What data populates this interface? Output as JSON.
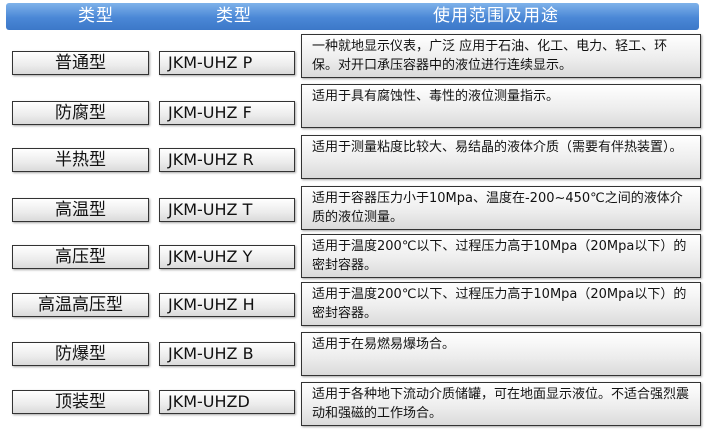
{
  "header": {
    "col1": "类型",
    "col2": "类型",
    "col3": "使用范围及用途"
  },
  "rows": [
    {
      "type": "普通型",
      "model": "JKM-UHZ P",
      "desc": "一种就地显示仪表，广泛 应用于石油、化工、电力、轻工、环保。对开口承压容器中的液位进行连续显示。"
    },
    {
      "type": "防腐型",
      "model": "JKM-UHZ F",
      "desc": "适用于具有腐蚀性、毒性的液位测量指示。"
    },
    {
      "type": "半热型",
      "model": "JKM-UHZ R",
      "desc": "适用于测量粘度比较大、易结晶的液体介质（需要有伴热装置）。"
    },
    {
      "type": "高温型",
      "model": "JKM-UHZ T",
      "desc": "适用于容器压力小于10Mpa、温度在-200~450℃之间的液体介质的液位测量。"
    },
    {
      "type": "高压型",
      "model": "JKM-UHZ Y",
      "desc": "适用于温度200℃以下、过程压力高于10Mpa（20Mpa以下）的密封容器。"
    },
    {
      "type": "高温高压型",
      "model": "JKM-UHZ H",
      "desc": "适用于温度200℃以下、过程压力高于10Mpa（20Mpa以下）的密封容器。"
    },
    {
      "type": "防爆型",
      "model": "JKM-UHZ B",
      "desc": "适用于在易燃易爆场合。"
    },
    {
      "type": "顶装型",
      "model": "JKM-UHZD",
      "desc": "适用于各种地下流动介质储罐，可在地面显示液位。不适合强烈震动和强磁的工作场合。"
    }
  ]
}
